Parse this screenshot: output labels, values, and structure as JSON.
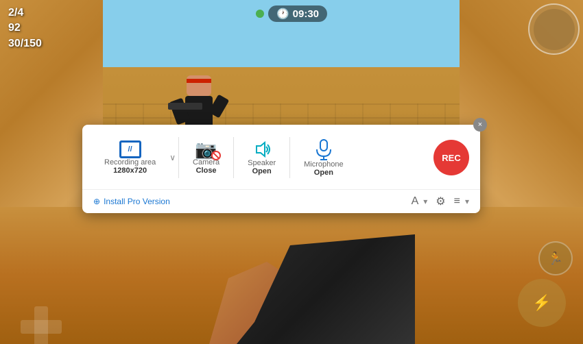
{
  "game": {
    "hud": {
      "score_fraction": "2/4",
      "ammo_main": "92",
      "ammo_reserve": "30/150",
      "timer": "09:30"
    }
  },
  "toolbar": {
    "close_label": "×",
    "recording_area": {
      "label": "Recording area",
      "value": "1280x720",
      "icon_label": "//"
    },
    "dropdown_arrow": "∨",
    "camera": {
      "label": "Camera",
      "status": "Close"
    },
    "speaker": {
      "label": "Speaker",
      "status": "Open"
    },
    "microphone": {
      "label": "Microphone",
      "status": "Open"
    },
    "rec_button": "REC",
    "install_pro": {
      "icon": "⊕",
      "label": "Install Pro Version"
    },
    "bottom_text_icon": "A",
    "bottom_settings_icon": "⚙",
    "bottom_menu_icon": "≡"
  }
}
